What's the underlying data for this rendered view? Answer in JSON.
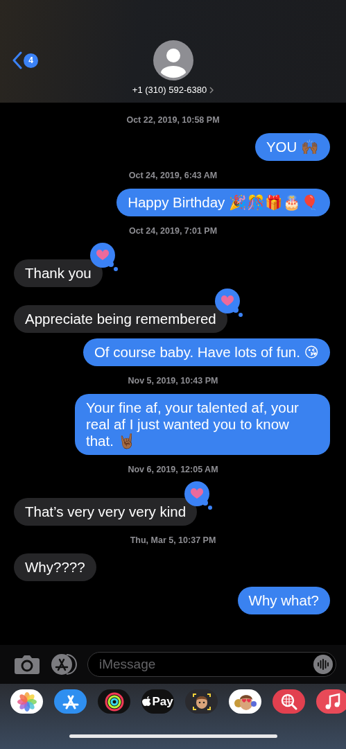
{
  "header": {
    "unread_count": "4",
    "contact": "+1 (310) 592-6380"
  },
  "thread": [
    {
      "kind": "timestamp",
      "text": "Oct 22, 2019, 10:58 PM"
    },
    {
      "kind": "sent",
      "text": "YOU 🙌🏾",
      "hearted": false
    },
    {
      "kind": "timestamp",
      "text": "Oct 24, 2019, 6:43 AM"
    },
    {
      "kind": "sent",
      "text": "Happy Birthday 🎉🎊🎁🎂🎈",
      "hearted": false
    },
    {
      "kind": "timestamp",
      "text": "Oct 24, 2019, 7:01 PM"
    },
    {
      "kind": "received",
      "text": "Thank you",
      "hearted": true
    },
    {
      "kind": "received",
      "text": "Appreciate being remembered",
      "hearted": true
    },
    {
      "kind": "sent",
      "text": "Of course baby. Have lots of fun. 😘",
      "hearted": false
    },
    {
      "kind": "timestamp",
      "text": "Nov 5, 2019, 10:43 PM"
    },
    {
      "kind": "sent",
      "text": "Your fine af, your talented af, your real af I just wanted you to know that. 🤘🏾",
      "hearted": false
    },
    {
      "kind": "timestamp",
      "text": "Nov 6, 2019, 12:05 AM"
    },
    {
      "kind": "received",
      "text": "That’s very very very kind",
      "hearted": true
    },
    {
      "kind": "timestamp",
      "text": "Thu, Mar 5, 10:37 PM"
    },
    {
      "kind": "received",
      "text": "Why????",
      "hearted": false
    },
    {
      "kind": "sent",
      "text": "Why what?",
      "hearted": false
    }
  ],
  "composer": {
    "placeholder": "iMessage"
  },
  "app_drawer": [
    {
      "kind": "photos"
    },
    {
      "kind": "appstore"
    },
    {
      "kind": "activity"
    },
    {
      "kind": "pay",
      "label": "Pay"
    },
    {
      "kind": "memoji"
    },
    {
      "kind": "stickers"
    },
    {
      "kind": "search"
    },
    {
      "kind": "music"
    }
  ]
}
